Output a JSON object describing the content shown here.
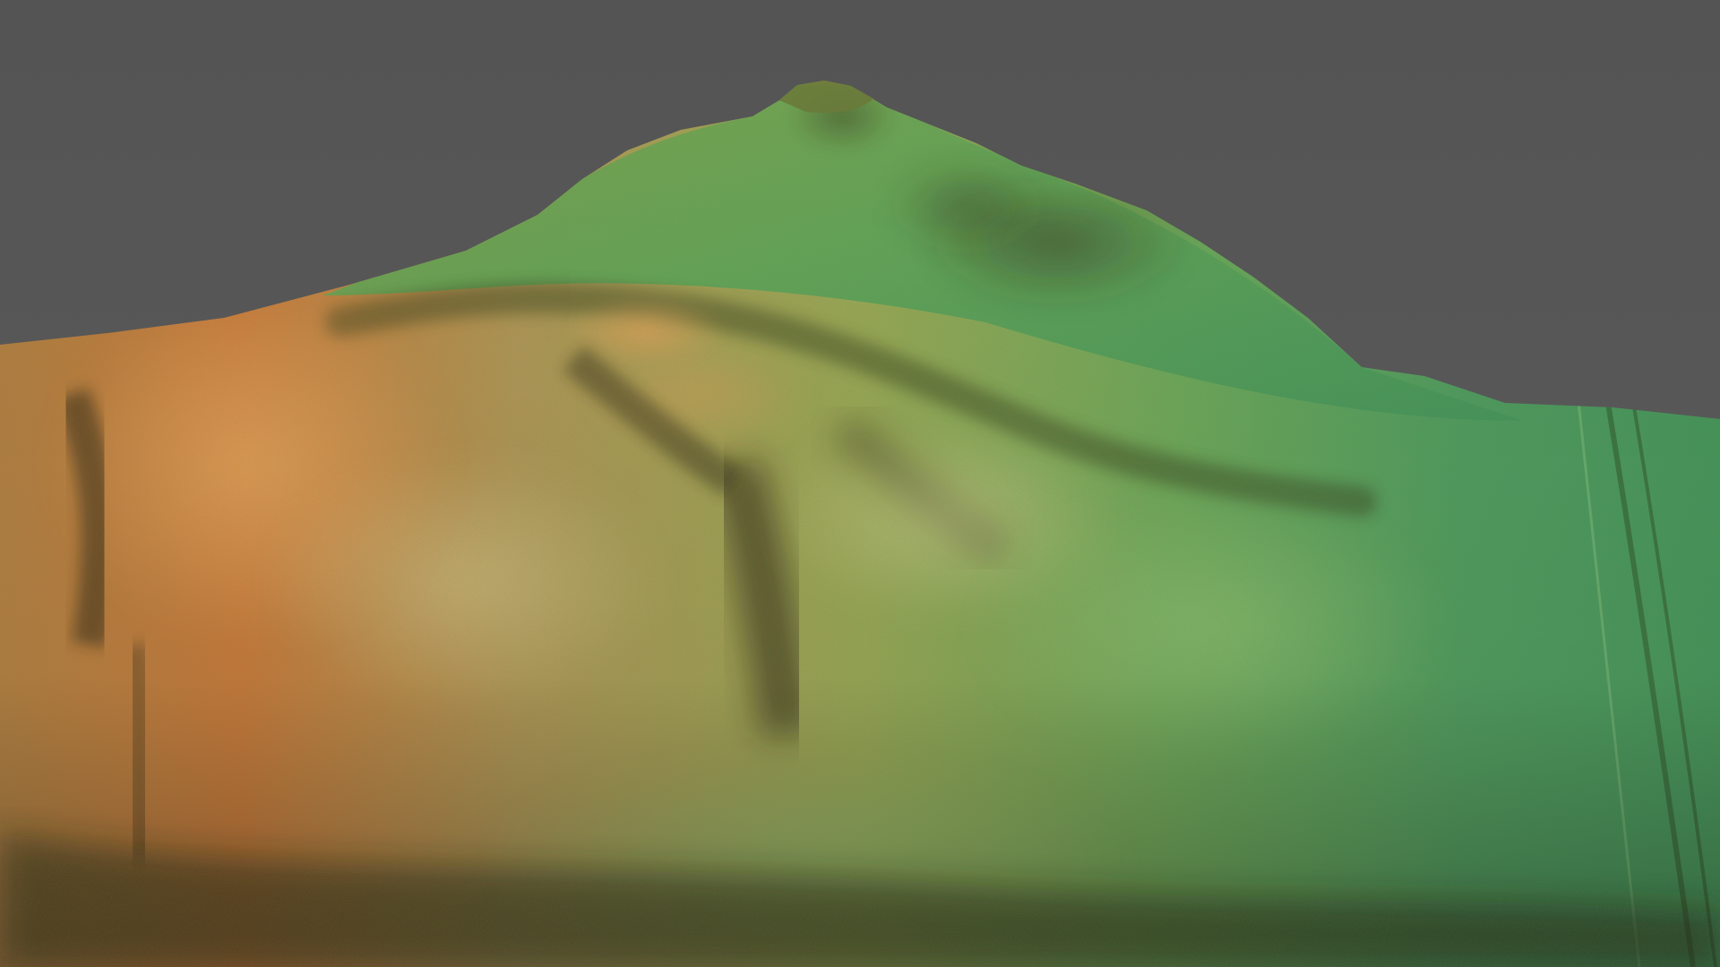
{
  "scene": {
    "subject": "terrain-elevation-render",
    "colors": {
      "background": "#555555",
      "low_elevation": "#3f9a5c",
      "mid_elevation": "#8fae4a",
      "high_elevation": "#c8783a",
      "highlight": "#e8a055",
      "shadow": "#3a3a1e"
    }
  }
}
